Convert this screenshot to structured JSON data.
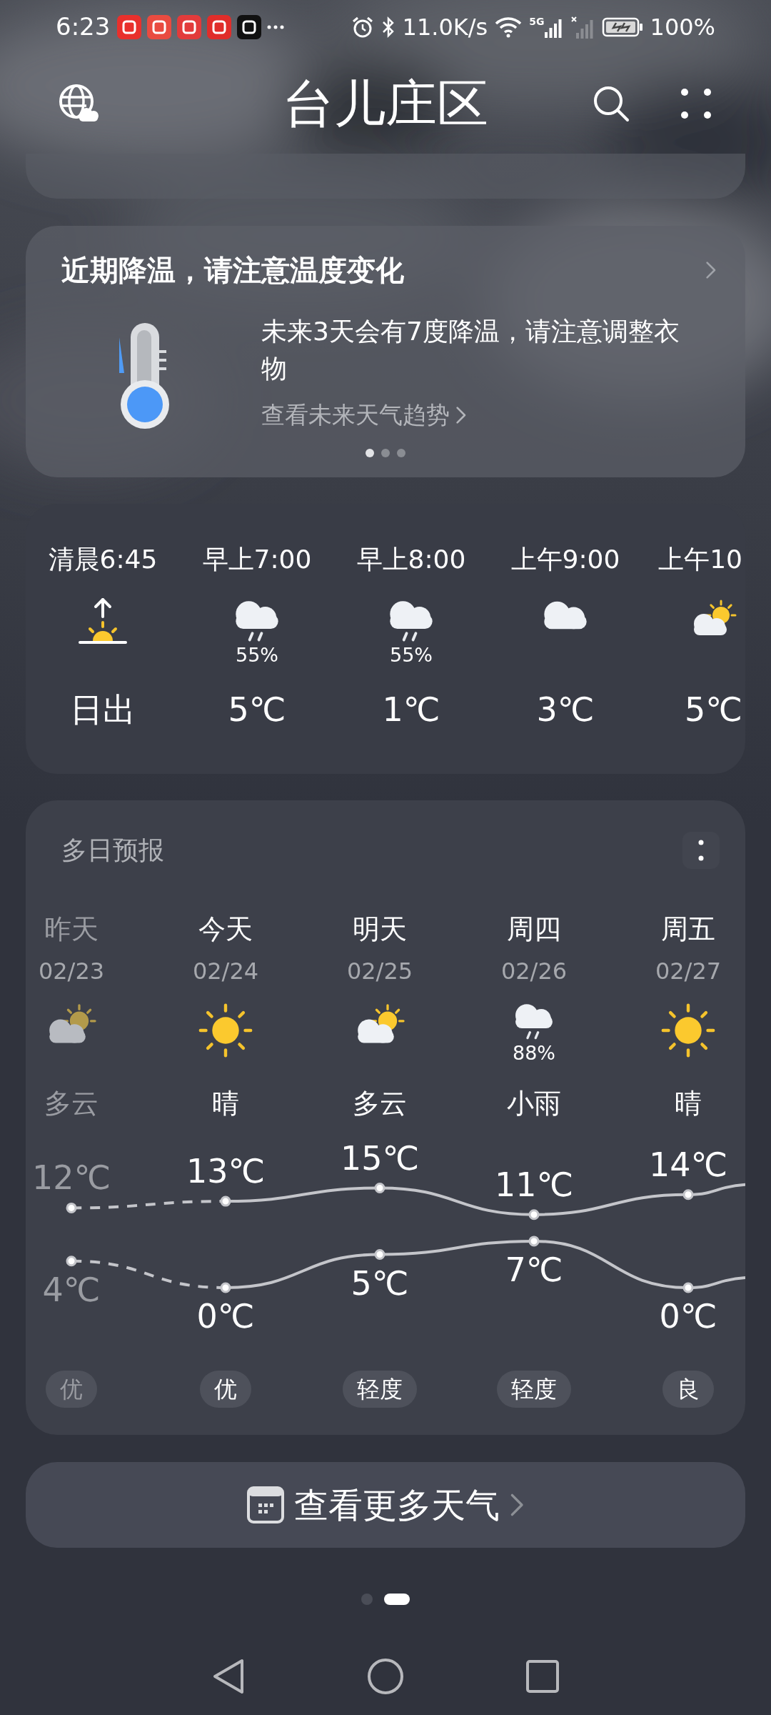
{
  "status_bar": {
    "time": "6:23",
    "net_speed": "11.0K/s",
    "network_type": "5G",
    "battery": "100%"
  },
  "header": {
    "title": "台儿庄区"
  },
  "alert": {
    "title": "近期降温，请注意温度变化",
    "message": "未来3天会有7度降温，请注意调整衣物",
    "link": "查看未来天气趋势",
    "pages": [
      {
        "selected": true
      },
      {
        "selected": false
      },
      {
        "selected": false
      }
    ]
  },
  "hourly": [
    {
      "time": "清晨6:45",
      "kind": "sunrise",
      "label": "日出"
    },
    {
      "time": "早上7:00",
      "kind": "rain",
      "precip": "55%",
      "label": "5℃"
    },
    {
      "time": "早上8:00",
      "kind": "rain",
      "precip": "55%",
      "label": "1℃"
    },
    {
      "time": "上午9:00",
      "kind": "cloudy",
      "label": "3℃"
    },
    {
      "time": "上午10",
      "kind": "partly_cloudy",
      "label": "5℃"
    }
  ],
  "daily": {
    "title": "多日预报",
    "days": [
      {
        "day": "昨天",
        "date": "02/23",
        "kind": "partly_cloudy",
        "condition": "多云",
        "high": "12℃",
        "low": "4℃",
        "aqi": "优",
        "past": true
      },
      {
        "day": "今天",
        "date": "02/24",
        "kind": "sunny",
        "condition": "晴",
        "high": "13℃",
        "low": "0℃",
        "aqi": "优",
        "past": false
      },
      {
        "day": "明天",
        "date": "02/25",
        "kind": "partly_cloudy",
        "condition": "多云",
        "high": "15℃",
        "low": "5℃",
        "aqi": "轻度",
        "past": false
      },
      {
        "day": "周四",
        "date": "02/26",
        "kind": "rain",
        "precip": "88%",
        "condition": "小雨",
        "high": "11℃",
        "low": "7℃",
        "aqi": "轻度",
        "past": false
      },
      {
        "day": "周五",
        "date": "02/27",
        "kind": "sunny",
        "condition": "晴",
        "high": "14℃",
        "low": "0℃",
        "aqi": "良",
        "past": false
      }
    ]
  },
  "more_button": {
    "label": "查看更多天气"
  },
  "pages": [
    {
      "selected": false
    },
    {
      "selected": true
    }
  ]
}
